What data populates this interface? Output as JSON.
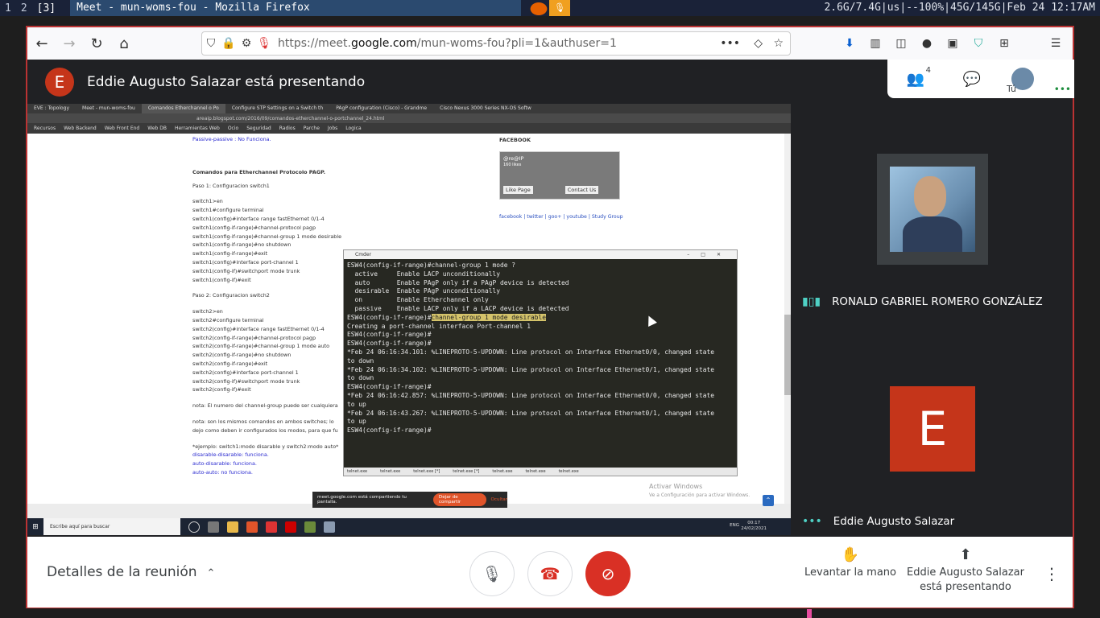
{
  "wm": {
    "workspaces": [
      "1",
      "2",
      "[3]"
    ],
    "window_title": "Meet - mun-woms-fou - Mozilla Firefox",
    "status": "2.6G/7.4G|us|--100%|45G/145G|Feb 24 12:17AM"
  },
  "browser": {
    "url_prefix": "https://meet.",
    "url_domain": "google.com",
    "url_rest": "/mun-woms-fou?pli=1&authuser=1"
  },
  "meet": {
    "presenter_initial": "E",
    "presenting_title": "Eddie Augusto Salazar está presentando",
    "participants_count": "4",
    "you_label": "Tú",
    "participant1_name": "RONALD GABRIEL ROMERO GONZÁLEZ",
    "participant2_initial": "E",
    "participant2_name": "Eddie Augusto Salazar",
    "details_label": "Detalles de la reunión",
    "raise_hand_label": "Levantar la mano",
    "presenting_line1": "Eddie Augusto Salazar",
    "presenting_line2": "está presentando"
  },
  "shared": {
    "tabs": [
      "EVE : Topology",
      "Meet - mun-woms-fou",
      "Comandos Etherchannel o Po",
      "Configure STP Settings on a Switch th",
      "PAgP configuration (Cisco) - Grandme",
      "Cisco Nexus 3000 Series NX-OS Softw"
    ],
    "address": "areaip.blogspot.com/2016/09/comandos-etherchannel-o-portchannel_24.html",
    "bookmarks": [
      "Recursos",
      "Web Backend",
      "Web Front End",
      "Web DB",
      "Herramientas Web",
      "Ocio",
      "Seguridad",
      "Radios",
      "Parche",
      "Jobs",
      "Logica"
    ],
    "blog_lines": [
      "Passive-passive : No Funciona.",
      "Comandos para Etherchannel Protocolo PAGP.",
      "Paso 1: Configuracion switch1",
      "switch1>en",
      "switch1#configure terminal",
      "switch1(config)#interface range fastEthernet 0/1-4",
      "switch1(config-if-range)#channel-protocol pagp",
      "switch1(config-if-range)#channel-group 1 mode desirable",
      "switch1(config-if-range)#no shutdown",
      "switch1(config-if-range)#exit",
      "switch1(config)#interface port-channel 1",
      "switch1(config-if)#switchport mode trunk",
      "switch1(config-if)#exit",
      "Paso 2: Configuracion switch2",
      "switch2>en",
      "switch2#configure terminal",
      "switch2(config)#interface range fastEthernet 0/1-4",
      "switch2(config-if-range)#channel-protocol pagp",
      "switch2(config-if-range)#channel-group 1 mode auto",
      "switch2(config-if-range)#no shutdown",
      "switch2(config-if-range)#exit",
      "switch2(config)#interface port-channel 1",
      "switch2(config-if)#switchport mode trunk",
      "switch2(config-if)#exit",
      "nota: El numero del channel-group puede ser cualquiera",
      "nota: son los mismos comandos en ambos switches; lo",
      "dejo como deben ir configurados los modos, para que fu",
      "*ejemplo: switch1:modo disarable y switch2:modo auto*",
      "disarable-disarable: funciona.",
      "auto-disarable: funciona.",
      "auto-auto: no funciona."
    ],
    "fb_heading": "FACEBOOK",
    "fb_name": "@re@IP",
    "fb_likes": "160 likes",
    "fb_like_btn": "Like Page",
    "fb_contact_btn": "Contact Us",
    "fb_links": "facebook | twitter | goo+ | youtube | Study Group",
    "cmder_title": "Cmder",
    "term_lines": [
      "ESW4(config-if-range)#channel-group 1 mode ?",
      "  active     Enable LACP unconditionally",
      "  auto       Enable PAgP only if a PAgP device is detected",
      "  desirable  Enable PAgP unconditionally",
      "  on         Enable Etherchannel only",
      "  passive    Enable LACP only if a LACP device is detected",
      "",
      "ESW4(config-if-range)#",
      "Creating a port-channel interface Port-channel 1",
      "",
      "ESW4(config-if-range)#",
      "ESW4(config-if-range)#",
      "*Feb 24 06:16:34.101: %LINEPROTO-5-UPDOWN: Line protocol on Interface Ethernet0/0, changed state",
      "to down",
      "*Feb 24 06:16:34.102: %LINEPROTO-5-UPDOWN: Line protocol on Interface Ethernet0/1, changed state",
      "to down",
      "ESW4(config-if-range)#",
      "*Feb 24 06:16:42.857: %LINEPROTO-5-UPDOWN: Line protocol on Interface Ethernet0/0, changed state",
      "to up",
      "*Feb 24 06:16:43.267: %LINEPROTO-5-UPDOWN: Line protocol on Interface Ethernet0/1, changed state",
      "to up",
      "ESW4(config-if-range)#"
    ],
    "term_highlight": "channel-group 1 mode desirable",
    "cmder_tabs": [
      "telnet.exe",
      "telnet.exe",
      "telnet.exe [*]",
      "telnet.exe [*]",
      "telnet.exe",
      "telnet.exe",
      "telnet.exe"
    ],
    "share_notice": "meet.google.com está compartiendo tu pantalla.",
    "share_stop": "Dejar de compartir",
    "share_hide": "Ocultar",
    "activate_title": "Activar Windows",
    "activate_sub": "Ve a Configuración para activar Windows.",
    "win_search": "Escribe aquí para buscar",
    "win_time": "00:17",
    "win_date": "24/02/2021",
    "win_lang": "ENG"
  }
}
